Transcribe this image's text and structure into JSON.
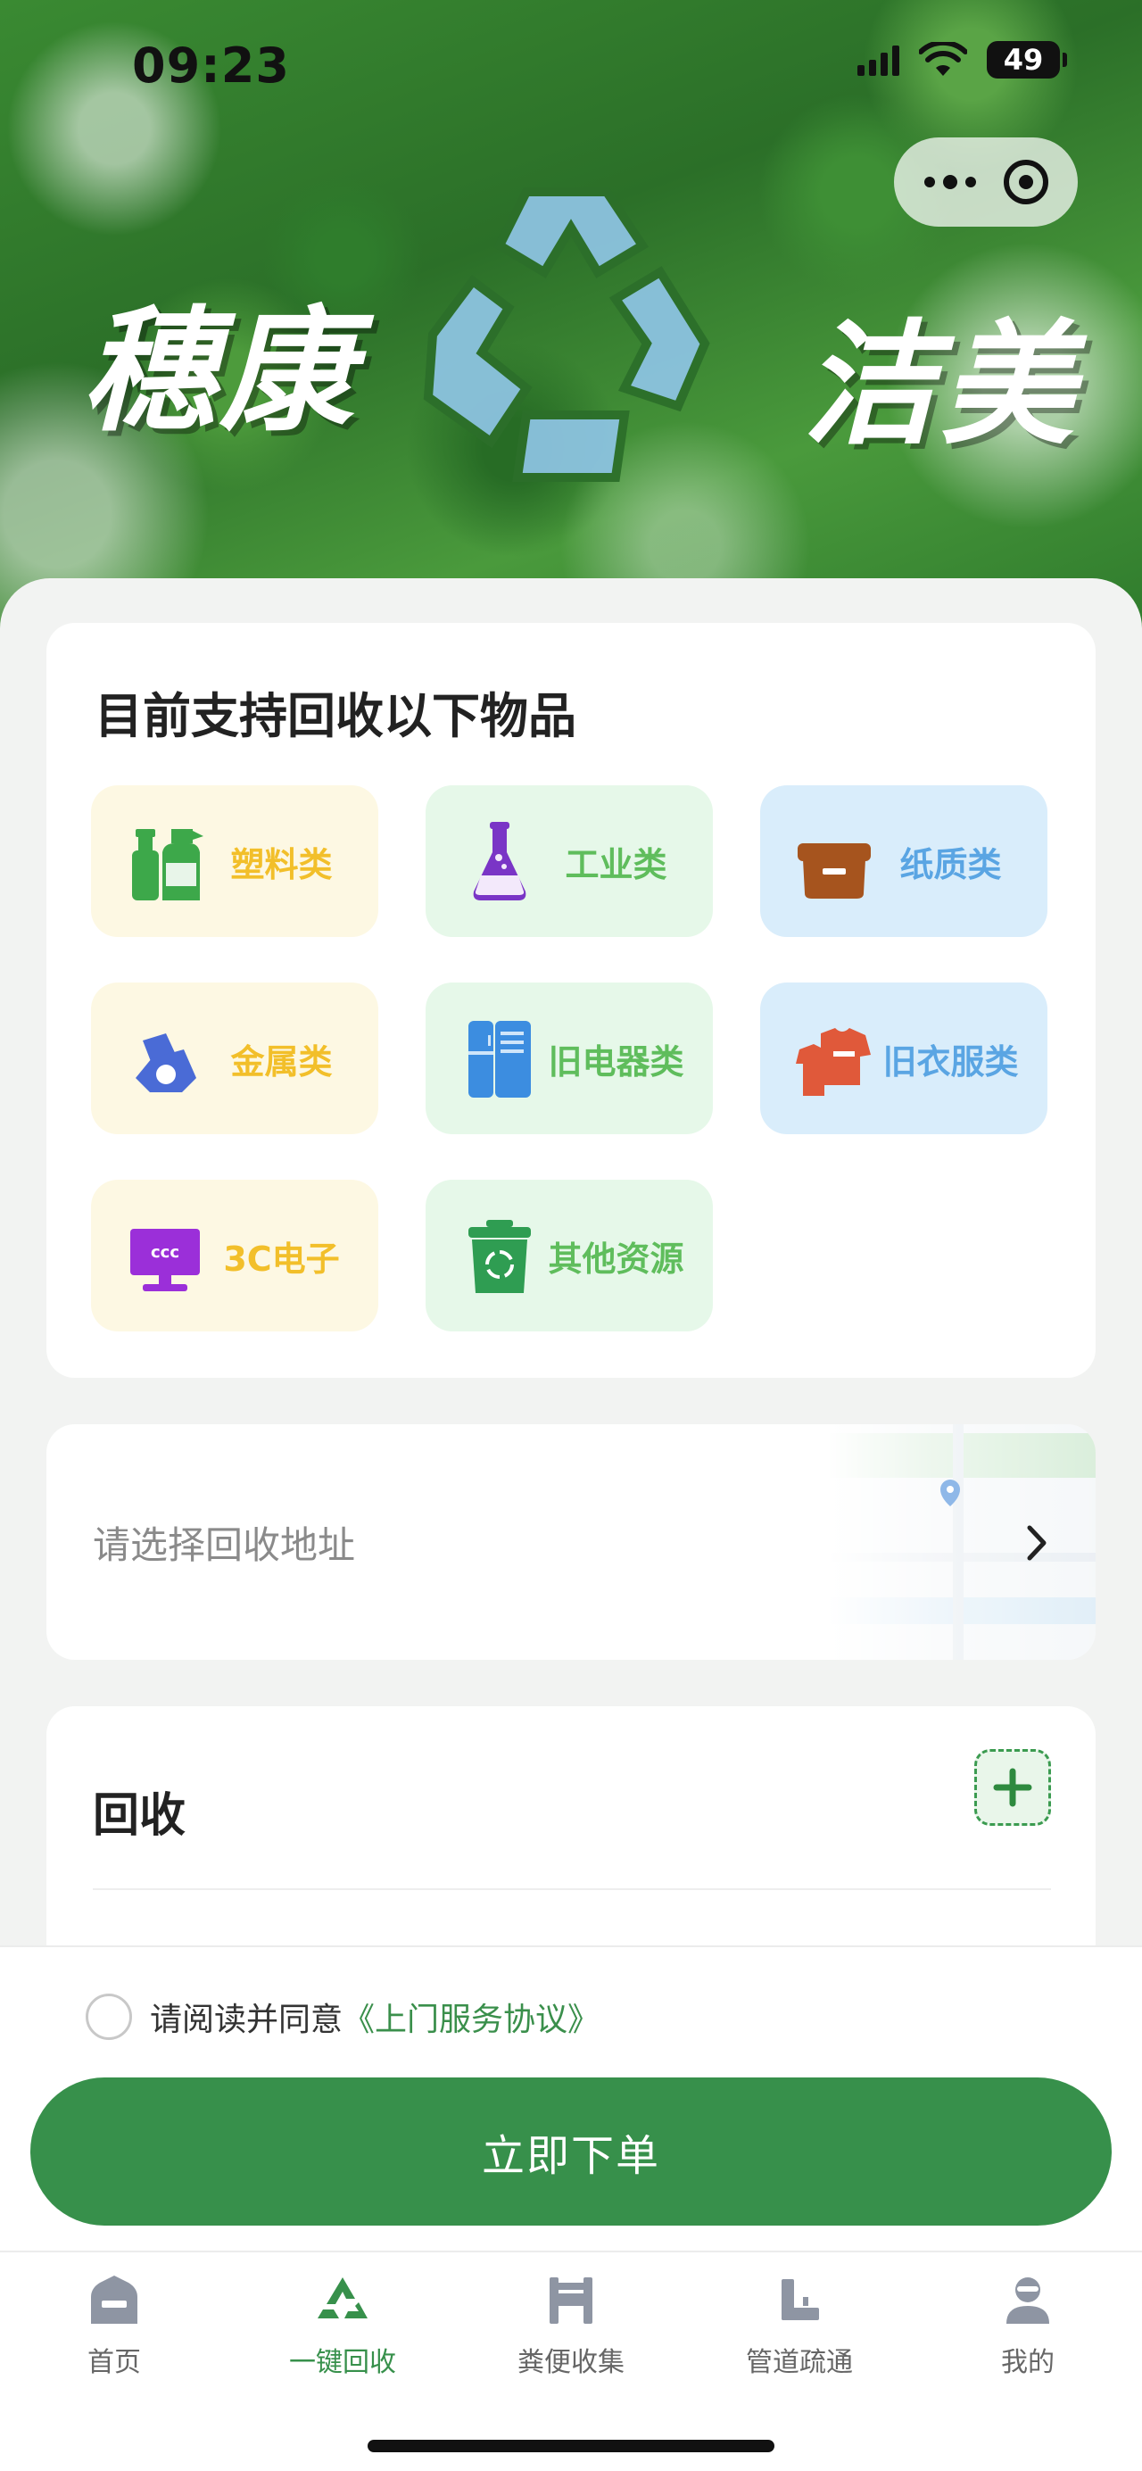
{
  "status_bar": {
    "time": "09:23",
    "battery": "49"
  },
  "hero": {
    "title_left": "穗康",
    "title_right": "洁美"
  },
  "items_section": {
    "title": "目前支持回收以下物品",
    "categories": [
      {
        "label": "塑料类",
        "icon": "plastic-bottle-icon",
        "color": "yellow"
      },
      {
        "label": "工业类",
        "icon": "flask-icon",
        "color": "green"
      },
      {
        "label": "纸质类",
        "icon": "paper-box-icon",
        "color": "blue"
      },
      {
        "label": "金属类",
        "icon": "metal-icon",
        "color": "yellow"
      },
      {
        "label": "旧电器类",
        "icon": "refrigerator-icon",
        "color": "green"
      },
      {
        "label": "旧衣服类",
        "icon": "clothes-icon",
        "color": "blue"
      },
      {
        "label": "3C电子",
        "icon": "monitor-icon",
        "color": "yellow"
      },
      {
        "label": "其他资源",
        "icon": "recycle-bin-icon",
        "color": "green"
      }
    ]
  },
  "address": {
    "placeholder": "请选择回收地址"
  },
  "recycle_section": {
    "title": "回收"
  },
  "agreement": {
    "text": "请阅读并同意",
    "link": "《上门服务协议》"
  },
  "order_button": {
    "label": "立即下单"
  },
  "tabbar": {
    "tabs": [
      {
        "label": "首页",
        "icon": "home-icon"
      },
      {
        "label": "一键回收",
        "icon": "recycle-triangle-icon",
        "active": true
      },
      {
        "label": "粪便收集",
        "icon": "collection-icon"
      },
      {
        "label": "管道疏通",
        "icon": "pipe-icon"
      },
      {
        "label": "我的",
        "icon": "user-icon"
      }
    ]
  },
  "colors": {
    "accent": "#37904b",
    "yellow_tile": "#fdf8e3",
    "green_tile": "#e6f8e9",
    "blue_tile": "#d9edfb"
  }
}
